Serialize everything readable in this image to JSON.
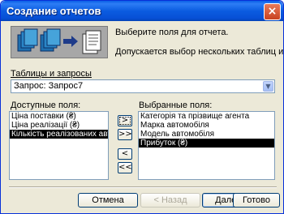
{
  "window": {
    "title": "Создание отчетов"
  },
  "info": {
    "line1": "Выберите поля для отчета.",
    "line2": "Допускается выбор нескольких таблиц или запросов."
  },
  "tables_label": "Таблицы и запросы",
  "tables_select": {
    "value": "Запрос: Запрос7"
  },
  "available_label": "Доступные поля:",
  "available_fields": [
    {
      "label": "Ціна поставки (₴)",
      "selected": false
    },
    {
      "label": "Ціна реалізації (₴)",
      "selected": false
    },
    {
      "label": "Кількість реалізованих авто",
      "selected": true
    }
  ],
  "selected_label": "Выбранные поля:",
  "selected_fields": [
    {
      "label": "Категорія та прізвище агента",
      "selected": false
    },
    {
      "label": "Марка автомобіля",
      "selected": false
    },
    {
      "label": "Модель автомобіля",
      "selected": false
    },
    {
      "label": "Прибуток (₴)",
      "selected": true
    }
  ],
  "move_buttons": {
    "add_one": ">",
    "add_all": ">>",
    "remove_one": "<",
    "remove_all": "<<"
  },
  "footer": {
    "cancel": "Отмена",
    "back": "< Назад",
    "next": "Далее >",
    "finish": "Готово"
  },
  "colors": {
    "title_bar": "#0a5fe6",
    "dialog_bg": "#ece9d8",
    "selection": "#000000"
  }
}
